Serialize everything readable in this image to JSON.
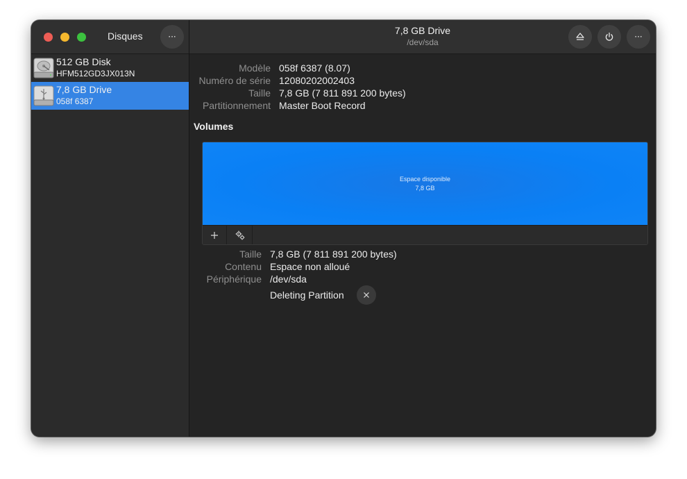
{
  "window": {
    "sidebar_title": "Disques",
    "title": "7,8 GB Drive",
    "subtitle": "/dev/sda",
    "menu_glyph": "···"
  },
  "sidebar": {
    "items": [
      {
        "name": "512 GB Disk",
        "sub": "HFM512GD3JX013N",
        "icon": "hard-disk-icon",
        "selected": false
      },
      {
        "name": "7,8 GB Drive",
        "sub": "058f 6387",
        "icon": "usb-drive-icon",
        "selected": true
      }
    ]
  },
  "drive_info": {
    "model_label": "Modèle",
    "model_value": "058f 6387 (8.07)",
    "serial_label": "Numéro de série",
    "serial_value": "12080202002403",
    "size_label": "Taille",
    "size_value": "7,8 GB (7 811 891 200 bytes)",
    "partitioning_label": "Partitionnement",
    "partitioning_value": "Master Boot Record"
  },
  "volumes": {
    "title": "Volumes",
    "segment_label": "Espace disponible",
    "segment_size": "7,8 GB",
    "segment_fraction": 1.0
  },
  "volume_info": {
    "size_label": "Taille",
    "size_value": "7,8 GB (7 811 891 200 bytes)",
    "content_label": "Contenu",
    "content_value": "Espace non alloué",
    "device_label": "Périphérique",
    "device_value": "/dev/sda",
    "status": "Deleting Partition"
  },
  "colors": {
    "accent": "#3584e4",
    "volume_fill": "#0a80f5",
    "background": "#242424"
  }
}
